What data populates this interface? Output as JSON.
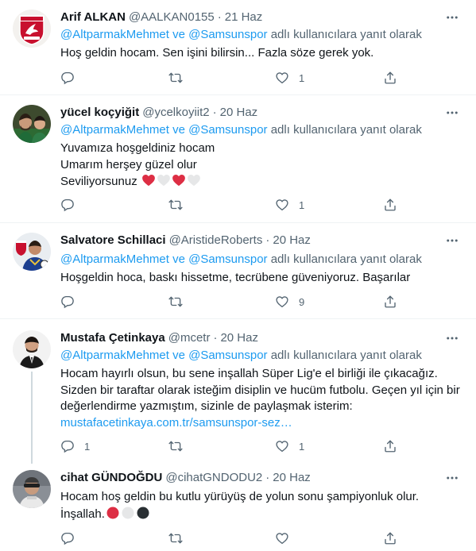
{
  "tweets": [
    {
      "name": "Arif ALKAN",
      "handle": "@AALKAN0155",
      "dot": "·",
      "time": "21 Haz",
      "reply_mentions": "@AltparmakMehmet ve @Samsunspor",
      "reply_suffix": " adlı kullanıcılara yanıt olarak",
      "lines": [
        "Hoş geldin hocam. Sen işini bilirsin... Fazla söze gerek yok."
      ],
      "counts": {
        "reply": "",
        "retweet": "",
        "like": "1",
        "share": ""
      }
    },
    {
      "name": "yücel koçyiğit",
      "handle": "@ycelkoyiit2",
      "dot": "·",
      "time": "20 Haz",
      "reply_mentions": "@AltparmakMehmet ve @Samsunspor",
      "reply_suffix": " adlı kullanıcılara yanıt olarak",
      "lines": [
        "Yuvamıza hoşgeldiniz hocam",
        "Umarım herşey güzel olur",
        "Seviliyorsunuz"
      ],
      "emojis": [
        "red-heart",
        "white-heart",
        "red-heart",
        "white-heart"
      ],
      "counts": {
        "reply": "",
        "retweet": "",
        "like": "1",
        "share": ""
      }
    },
    {
      "name": "Salvatore Schillaci",
      "handle": "@AristideRoberts",
      "dot": "·",
      "time": "20 Haz",
      "reply_mentions": "@AltparmakMehmet ve @Samsunspor",
      "reply_suffix": " adlı kullanıcılara yanıt olarak",
      "lines": [
        "Hoşgeldin hoca, baskı hissetme, tecrübene güveniyoruz. Başarılar"
      ],
      "counts": {
        "reply": "",
        "retweet": "",
        "like": "9",
        "share": ""
      }
    },
    {
      "name": "Mustafa Çetinkaya",
      "handle": "@mcetr",
      "dot": "·",
      "time": "20 Haz",
      "reply_mentions": "@AltparmakMehmet ve @Samsunspor",
      "reply_suffix": " adlı kullanıcılara yanıt olarak",
      "lines": [
        "Hocam hayırlı olsun, bu sene inşallah Süper Lig'e el birliği ile çıkacağız.",
        "Sizden bir taraftar olarak isteğim disiplin ve hucüm futbolu. Geçen yıl için bir",
        "değerlendirme yazmıştım, sizinle de paylaşmak isterim:"
      ],
      "link": "mustafacetinkaya.com.tr/samsunspor-sez…",
      "counts": {
        "reply": "1",
        "retweet": "",
        "like": "1",
        "share": ""
      }
    },
    {
      "name": "cihat GÜNDOĞDU",
      "handle": "@cihatGNDODU2",
      "dot": "·",
      "time": "20 Haz",
      "lines": [
        "Hocam hoş geldin bu kutlu yürüyüş de yolun sonu şampiyonluk olur.",
        "İnşallah."
      ],
      "emojis": [
        "red-circle",
        "white-circle",
        "black-circle"
      ],
      "counts": {
        "reply": "",
        "retweet": "",
        "like": "",
        "share": ""
      }
    }
  ],
  "colors": {
    "link": "#1d9bf0",
    "secondary_text": "#536471",
    "primary_text": "#0f1419",
    "divider": "#eff3f4",
    "thread_line": "#cfd9de"
  }
}
